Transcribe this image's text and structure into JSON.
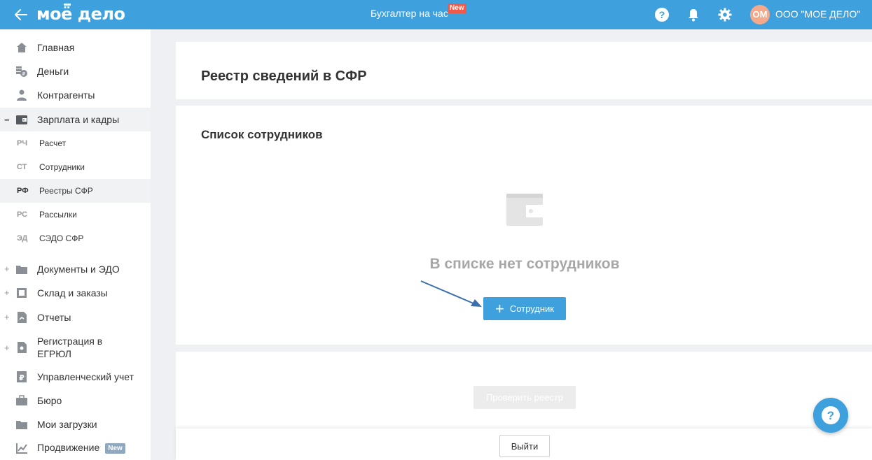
{
  "header": {
    "logo": "моё дело",
    "hour_link": "Бухгалтер на час",
    "hour_badge": "New",
    "avatar_initials": "ОМ",
    "org_name": "ООО \"МОЕ ДЕЛО\"",
    "brand_color": "#3ea0dd"
  },
  "sidebar": {
    "items": [
      {
        "label": "Главная",
        "icon": "home-icon"
      },
      {
        "label": "Деньги",
        "icon": "money-icon"
      },
      {
        "label": "Контрагенты",
        "icon": "contractors-icon"
      },
      {
        "label": "Зарплата и кадры",
        "icon": "wallet-icon",
        "expander": "−"
      },
      {
        "label": "Документы и ЭДО",
        "icon": "folder-icon",
        "expander": "+"
      },
      {
        "label": "Склад и заказы",
        "icon": "warehouse-icon",
        "expander": "+"
      },
      {
        "label": "Отчеты",
        "icon": "reports-icon",
        "expander": "+"
      },
      {
        "label": "Регистрация в ЕГРЮЛ",
        "icon": "registration-icon",
        "expander": "+"
      },
      {
        "label": "Управленческий учет",
        "icon": "ruble-doc-icon"
      },
      {
        "label": "Бюро",
        "icon": "briefcase-icon"
      },
      {
        "label": "Мои загрузки",
        "icon": "folder-icon"
      },
      {
        "label": "Продвижение",
        "icon": "chart-icon",
        "badge": "New"
      }
    ],
    "sub_items": [
      {
        "abbr": "РЧ",
        "label": "Расчет"
      },
      {
        "abbr": "СТ",
        "label": "Сотрудники"
      },
      {
        "abbr": "РФ",
        "label": "Реестры СФР"
      },
      {
        "abbr": "РС",
        "label": "Рассылки"
      },
      {
        "abbr": "ЭД",
        "label": "СЭДО СФР"
      }
    ]
  },
  "main": {
    "page_title": "Реестр сведений в СФР",
    "section_title": "Список сотрудников",
    "empty_text": "В списке нет сотрудников",
    "add_button": "Сотрудник",
    "check_button": "Проверить реестр",
    "exit_button": "Выйти"
  }
}
